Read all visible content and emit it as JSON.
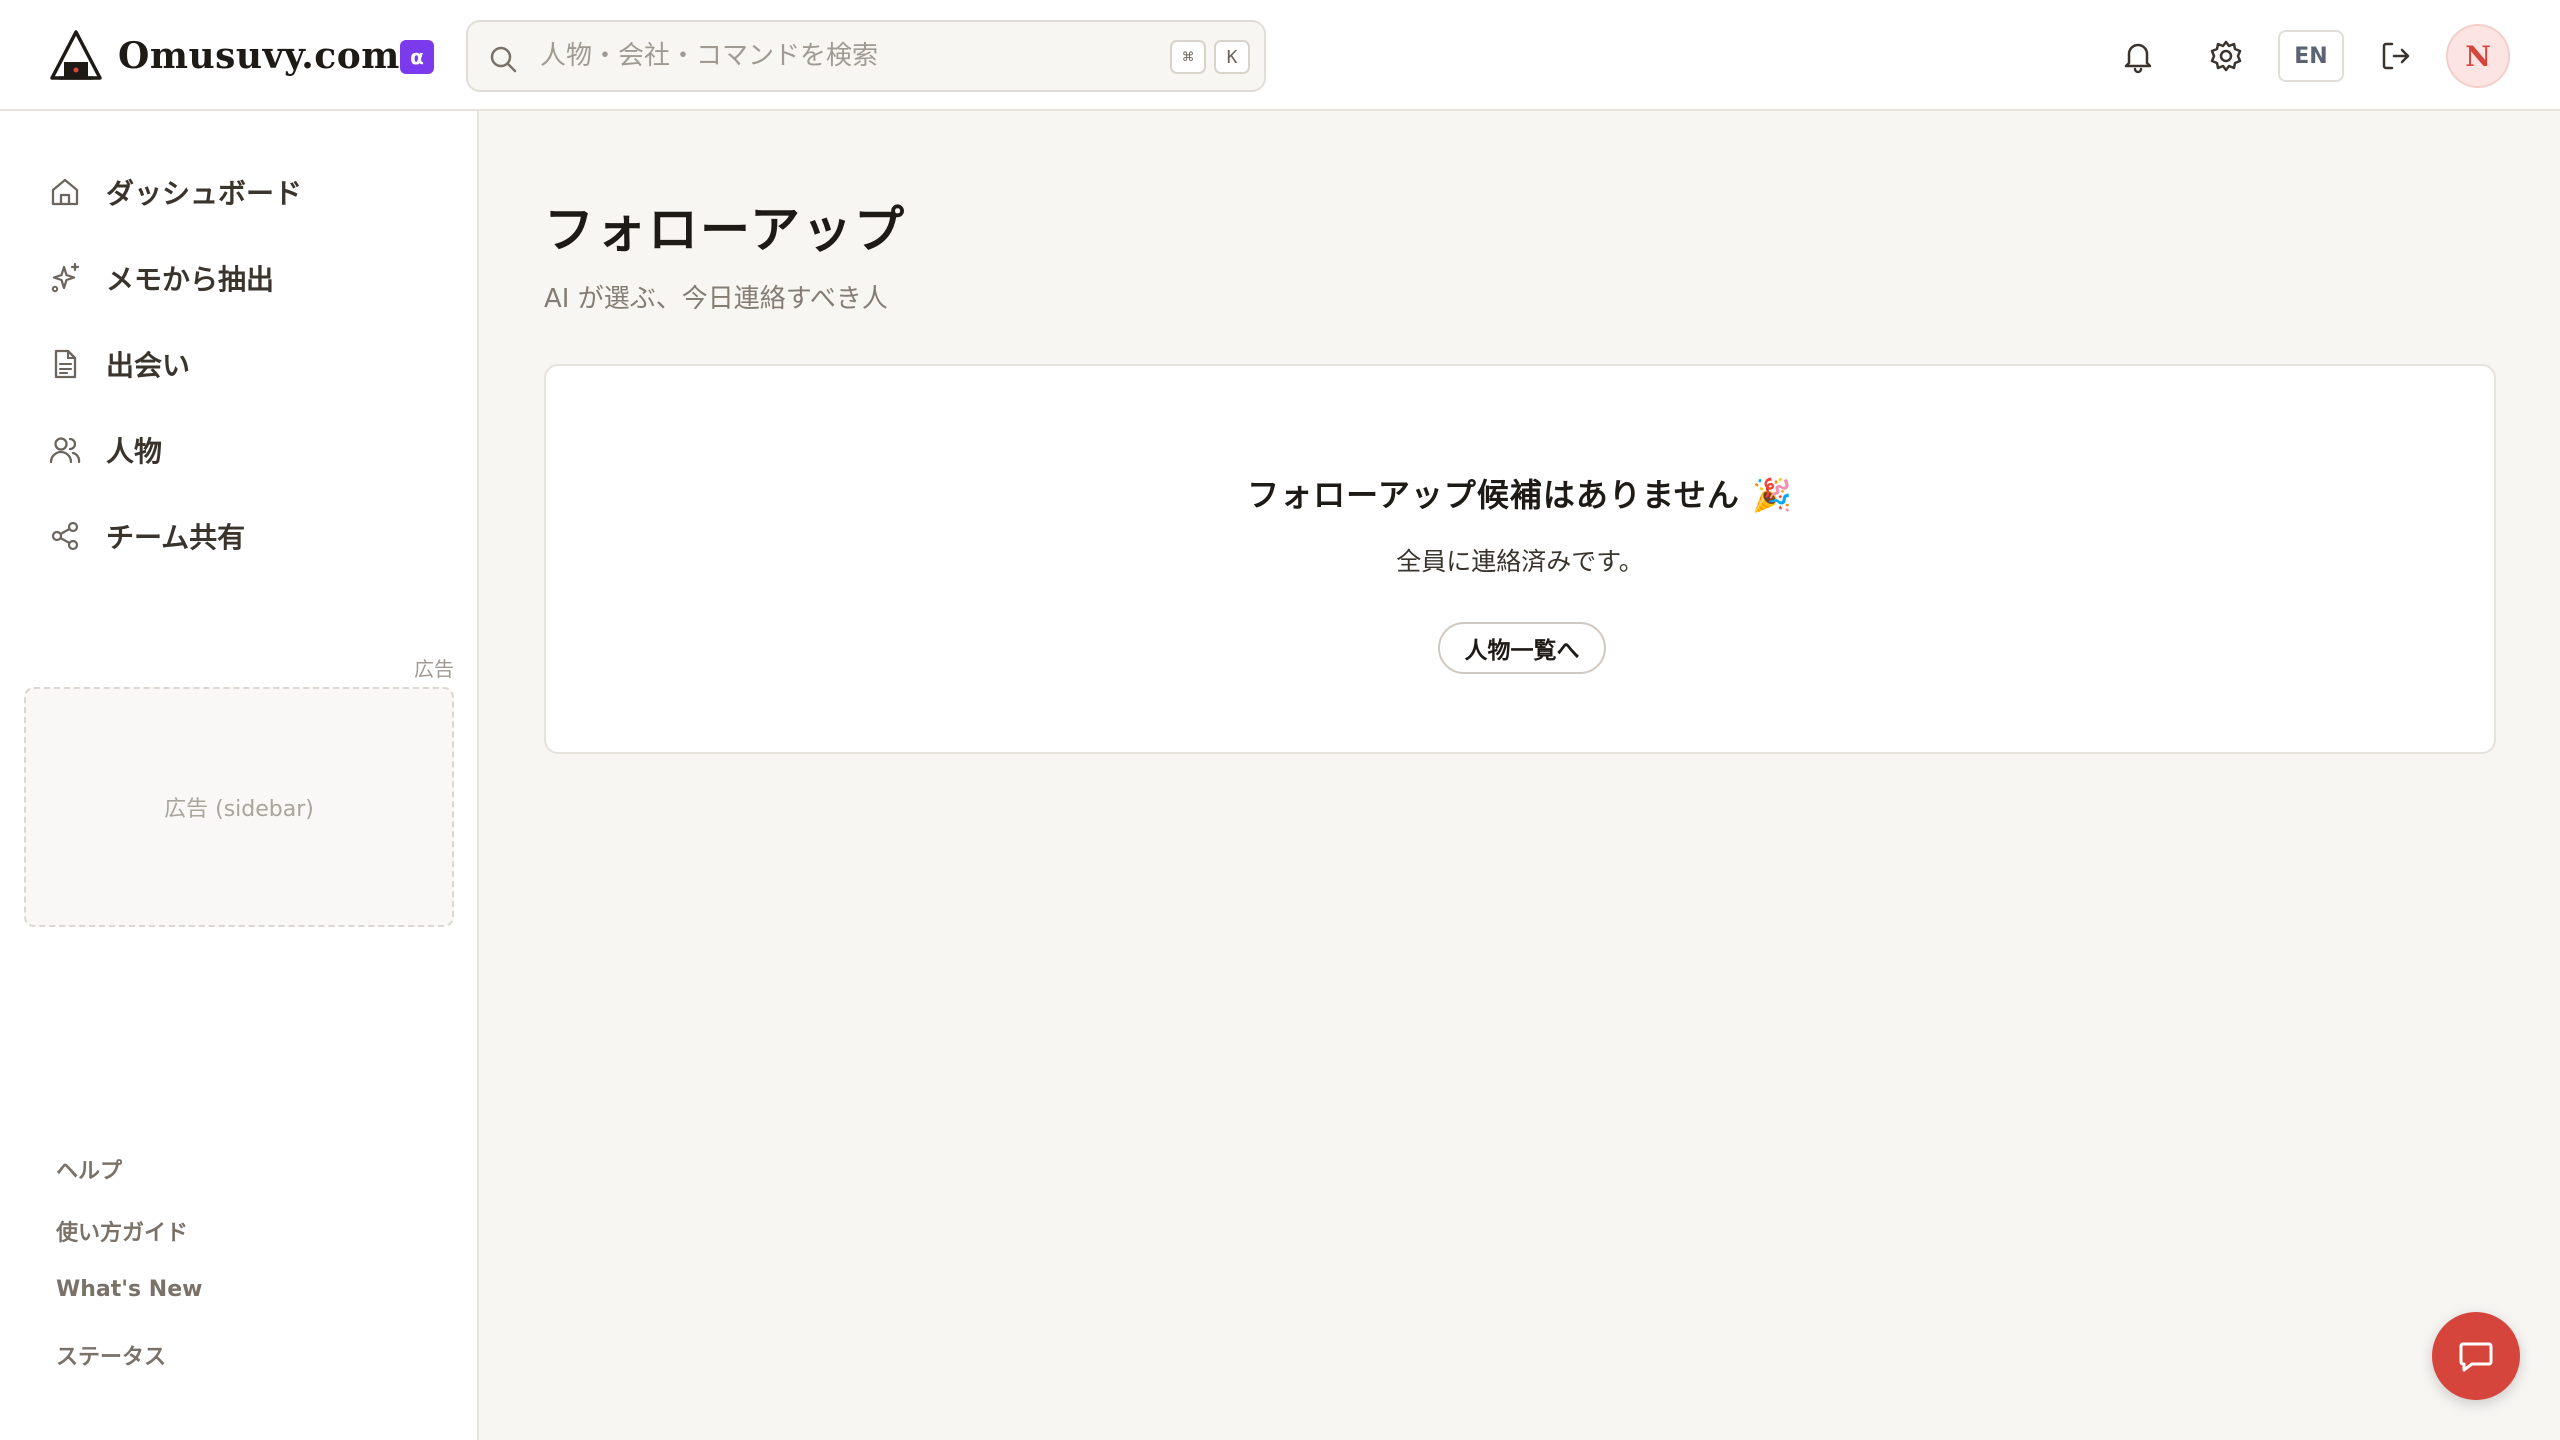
{
  "header": {
    "logo_text": "Omusuvy.com",
    "alpha_badge": "α",
    "search": {
      "placeholder": "人物・会社・コマンドを検索",
      "shortcut_modifier": "⌘",
      "shortcut_key": "K"
    },
    "language_button": "EN",
    "avatar_initial": "N"
  },
  "sidebar": {
    "items": [
      {
        "label": "ダッシュボード",
        "icon": "home-icon"
      },
      {
        "label": "メモから抽出",
        "icon": "sparkles-icon"
      },
      {
        "label": "出会い",
        "icon": "document-icon"
      },
      {
        "label": "人物",
        "icon": "users-icon"
      },
      {
        "label": "チーム共有",
        "icon": "share-icon"
      }
    ],
    "ad_label": "広告",
    "ad_placeholder": "広告 (sidebar)",
    "footer_links": [
      "ヘルプ",
      "使い方ガイド",
      "What's New",
      "ステータス"
    ]
  },
  "main": {
    "title": "フォローアップ",
    "subtitle": "AI が選ぶ、今日連絡すべき人",
    "empty_state": {
      "title": "フォローアップ候補はありません 🎉",
      "description": "全員に連絡済みです。",
      "button_label": "人物一覧へ"
    }
  },
  "colors": {
    "accent": "#d6453b",
    "alpha_badge": "#7c3aed",
    "background": "#f7f6f3"
  }
}
